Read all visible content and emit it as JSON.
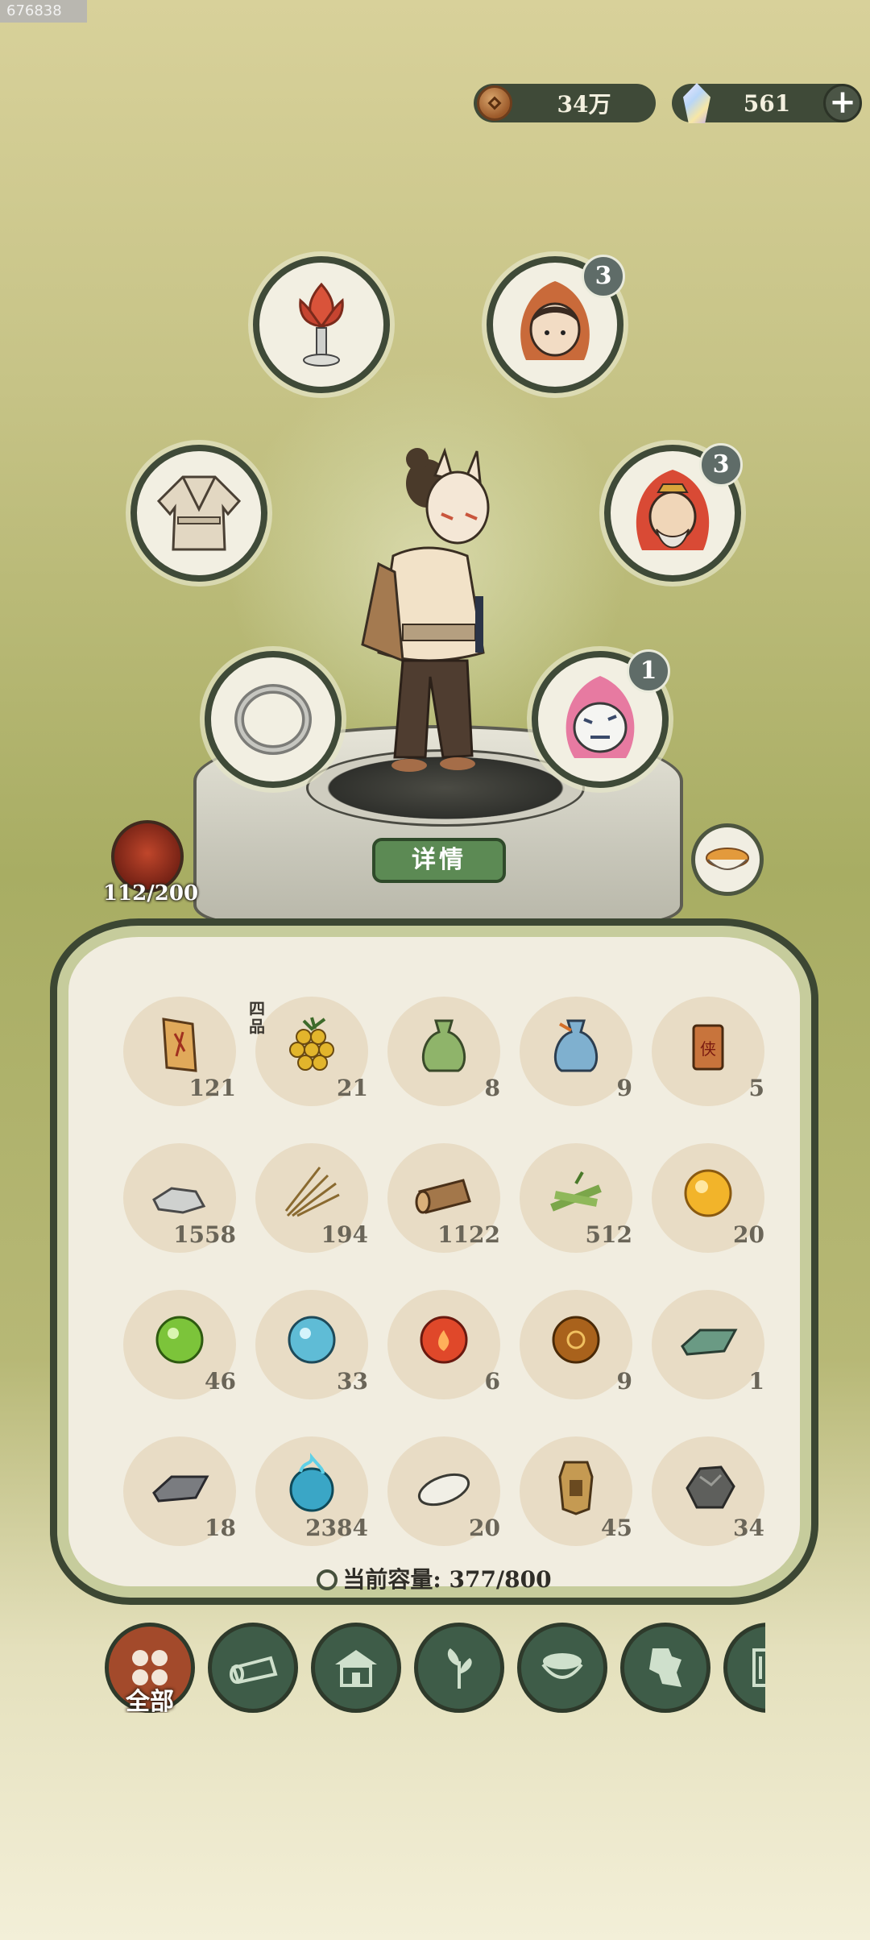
{
  "corner_id": "676838",
  "currency": {
    "coins": {
      "icon": "coin-icon",
      "value": "34万"
    },
    "gems": {
      "icon": "gem-icon",
      "value": "561",
      "add_icon": "plus-icon"
    }
  },
  "equipment": [
    {
      "name": "lotus-lamp",
      "icon": "lotus-lamp-icon"
    },
    {
      "name": "companion-girl",
      "icon": "girl-portrait-icon",
      "badge": "3"
    },
    {
      "name": "robe",
      "icon": "robe-icon"
    },
    {
      "name": "companion-elder",
      "icon": "elder-portrait-icon",
      "badge": "3"
    },
    {
      "name": "ring",
      "icon": "ring-icon"
    },
    {
      "name": "white-tiger",
      "icon": "tiger-icon",
      "badge": "1"
    }
  ],
  "pet": {
    "icon": "pet-portrait-icon",
    "count": "112/200"
  },
  "detail_button": "详情",
  "food_icon": "food-bowl-icon",
  "inventory": [
    {
      "icon": "scroll-icon",
      "qty": "121"
    },
    {
      "icon": "grape-icon",
      "qty": "21",
      "grade": "四品"
    },
    {
      "icon": "green-pouch-icon",
      "qty": "8"
    },
    {
      "icon": "blue-pouch-icon",
      "qty": "9"
    },
    {
      "icon": "token-icon",
      "qty": "5"
    },
    {
      "icon": "stone-icon",
      "qty": "1558"
    },
    {
      "icon": "grass-icon",
      "qty": "194"
    },
    {
      "icon": "log-icon",
      "qty": "1122"
    },
    {
      "icon": "bamboo-icon",
      "qty": "512"
    },
    {
      "icon": "gold-orb-icon",
      "qty": "20"
    },
    {
      "icon": "green-orb-icon",
      "qty": "46"
    },
    {
      "icon": "blue-orb-icon",
      "qty": "33"
    },
    {
      "icon": "red-orb-icon",
      "qty": "6"
    },
    {
      "icon": "brown-orb-icon",
      "qty": "9"
    },
    {
      "icon": "jade-ingot-icon",
      "qty": "1"
    },
    {
      "icon": "iron-ingot-icon",
      "qty": "18"
    },
    {
      "icon": "spirit-flame-icon",
      "qty": "2384"
    },
    {
      "icon": "white-stone-icon",
      "qty": "20"
    },
    {
      "icon": "plaque-icon",
      "qty": "45"
    },
    {
      "icon": "ore-icon",
      "qty": "34"
    }
  ],
  "capacity": "当前容量: 377/800",
  "tabs": [
    {
      "icon": "all-grid-icon",
      "label": "全部",
      "active": true
    },
    {
      "icon": "log-tab-icon"
    },
    {
      "icon": "house-tab-icon"
    },
    {
      "icon": "herb-tab-icon"
    },
    {
      "icon": "bowl-tab-icon"
    },
    {
      "icon": "puzzle-tab-icon"
    },
    {
      "icon": "book-tab-icon"
    }
  ]
}
